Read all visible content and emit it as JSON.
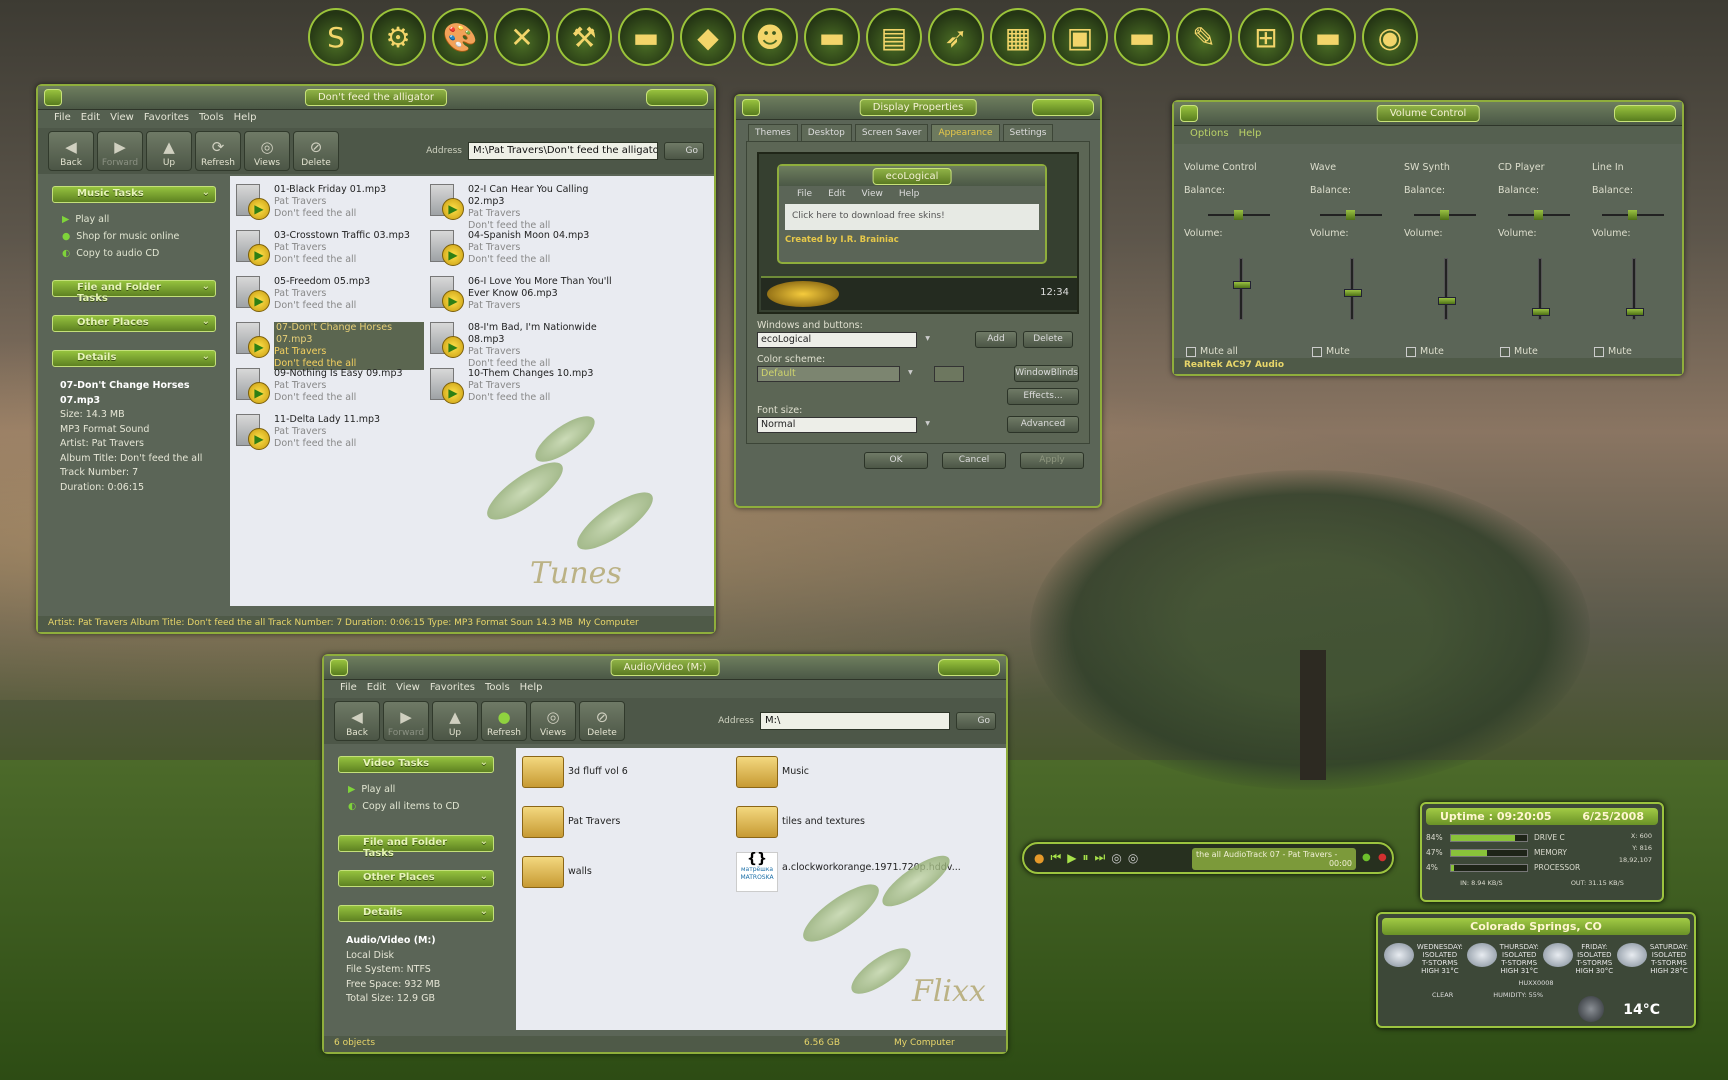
{
  "dock": [
    "s-logo-icon",
    "tools-icon",
    "palette-icon",
    "close-x-icon",
    "hammer-icon",
    "folder-icon",
    "shapes-icon",
    "user-icon",
    "folder-icon",
    "drive-icon",
    "xp-cursor-icon",
    "clapper-icon",
    "monitor-icon",
    "folder-icon",
    "pencil-icon",
    "windows-icon",
    "folder-icon",
    "globe-icon"
  ],
  "tunes": {
    "title": "Don't feed the alligator",
    "menu": [
      "File",
      "Edit",
      "View",
      "Favorites",
      "Tools",
      "Help"
    ],
    "toolbar": [
      "Back",
      "Forward",
      "Up",
      "Refresh",
      "Views",
      "Delete"
    ],
    "address_label": "Address",
    "address": "M:\\Pat Travers\\Don't feed the alligator",
    "go": "Go",
    "music_tasks": "Music Tasks",
    "tasks": [
      "Play all",
      "Shop for music online",
      "Copy to audio CD"
    ],
    "file_tasks": "File and Folder Tasks",
    "other_places": "Other Places",
    "details": "Details",
    "detail_name": "07-Don't Change Horses 07.mp3",
    "detail_lines": [
      "Size: 14.3 MB",
      "MP3 Format Sound",
      "Artist: Pat Travers",
      "Album Title: Don't feed the all",
      "Track Number: 7",
      "Duration: 0:06:15"
    ],
    "files": [
      {
        "name": "01-Black Friday 01.mp3",
        "artist": "Pat Travers",
        "album": "Don't feed the all"
      },
      {
        "name": "02-I Can Hear You Calling  02.mp3",
        "artist": "Pat Travers",
        "album": "Don't feed the all"
      },
      {
        "name": "03-Crosstown Traffic  03.mp3",
        "artist": "Pat Travers",
        "album": "Don't feed the all"
      },
      {
        "name": "04-Spanish Moon  04.mp3",
        "artist": "Pat Travers",
        "album": "Don't feed the all"
      },
      {
        "name": "05-Freedom  05.mp3",
        "artist": "Pat Travers",
        "album": "Don't feed the all"
      },
      {
        "name": "06-I Love You More Than You'll Ever Know  06.mp3",
        "artist": "Pat Travers",
        "album": ""
      },
      {
        "name": "07-Don't Change Horses   07.mp3",
        "artist": "Pat Travers",
        "album": "Don't feed the all"
      },
      {
        "name": "08-I'm Bad, I'm Nationwide   08.mp3",
        "artist": "Pat Travers",
        "album": "Don't feed the all"
      },
      {
        "name": "09-Nothing Is Easy  09.mp3",
        "artist": "Pat Travers",
        "album": "Don't feed the all"
      },
      {
        "name": "10-Them Changes  10.mp3",
        "artist": "Pat Travers",
        "album": "Don't feed the all"
      },
      {
        "name": "11-Delta Lady  11.mp3",
        "artist": "Pat Travers",
        "album": "Don't feed the all"
      }
    ],
    "watermark": "Tunes",
    "status": "Artist: Pat Travers Album Title: Don't feed the all Track Number: 7 Duration: 0:06:15 Type: MP3 Format Soun  14.3 MB",
    "status_right": "My Computer"
  },
  "display": {
    "title": "Display Properties",
    "tabs": [
      "Themes",
      "Desktop",
      "Screen Saver",
      "Appearance",
      "Settings"
    ],
    "preview_title": "ecoLogical",
    "preview_menu": [
      "File",
      "Edit",
      "View",
      "Help"
    ],
    "preview_text": "Click here to download free skins!",
    "preview_credit": "Created by I.R. Brainiac",
    "preview_time": "12:34",
    "win_label": "Windows and buttons:",
    "win_value": "ecoLogical",
    "color_label": "Color scheme:",
    "color_value": "Default",
    "font_label": "Font size:",
    "font_value": "Normal",
    "btn_add": "Add",
    "btn_delete": "Delete",
    "btn_wb": "WindowBlinds",
    "btn_effects": "Effects...",
    "btn_advanced": "Advanced",
    "btn_ok": "OK",
    "btn_cancel": "Cancel",
    "btn_apply": "Apply"
  },
  "volume": {
    "title": "Volume Control",
    "menu": [
      "Options",
      "Help"
    ],
    "channels": [
      {
        "name": "Volume Control",
        "mute": "Mute all",
        "level": 0.6
      },
      {
        "name": "Wave",
        "mute": "Mute",
        "level": 0.45
      },
      {
        "name": "SW Synth",
        "mute": "Mute",
        "level": 0.3
      },
      {
        "name": "CD Player",
        "mute": "Mute",
        "level": 0.1
      },
      {
        "name": "Line In",
        "mute": "Mute",
        "level": 0.1
      }
    ],
    "balance": "Balance:",
    "volume": "Volume:",
    "status": "Realtek AC97 Audio"
  },
  "flixx": {
    "title": "Audio/Video (M:)",
    "menu": [
      "File",
      "Edit",
      "View",
      "Favorites",
      "Tools",
      "Help"
    ],
    "toolbar": [
      "Back",
      "Forward",
      "Up",
      "Refresh",
      "Views",
      "Delete"
    ],
    "address_label": "Address",
    "address": "M:\\",
    "go": "Go",
    "video_tasks": "Video Tasks",
    "tasks": [
      "Play all",
      "Copy all items to CD"
    ],
    "file_tasks": "File and Folder Tasks",
    "other_places": "Other Places",
    "details": "Details",
    "detail_name": "Audio/Video (M:)",
    "detail_lines": [
      "Local Disk",
      "File System: NTFS",
      "Free Space: 932 MB",
      "Total Size: 12.9 GB"
    ],
    "items": [
      "3d fluff vol 6",
      "Music",
      "Pat Travers",
      "tiles and textures",
      "walls",
      "a.clockworkorange.1971.720p.hddv..."
    ],
    "mkv_label": "матрёшка MATROSKA",
    "watermark": "Flixx",
    "status_left": "6 objects",
    "status_mid": "6.56 GB",
    "status_right": "My Computer"
  },
  "player": {
    "text": "the all   AudioTrack 07 - Pat Travers -",
    "time": "00:00"
  },
  "sysmon": {
    "uptime": "Uptime : 09:20:05",
    "date": "6/25/2008",
    "rows": [
      {
        "pct": "84%",
        "label": "DRIVE C",
        "fill": 0.84
      },
      {
        "pct": "47%",
        "label": "MEMORY",
        "fill": 0.47
      },
      {
        "pct": "4%",
        "label": "PROCESSOR",
        "fill": 0.04
      }
    ],
    "xy": [
      "X:  600",
      "Y:  816",
      "18,92,107"
    ],
    "in": "IN:    8.94 KB/S",
    "out": "OUT:    31.15 KB/S"
  },
  "weather": {
    "city": "Colorado Springs, CO",
    "days": [
      {
        "d": "WEDNESDAY:",
        "c": "ISOLATED",
        "t": "T-STORMS",
        "h": "HIGH 31°C"
      },
      {
        "d": "THURSDAY:",
        "c": "ISOLATED",
        "t": "T-STORMS",
        "h": "HIGH 31°C"
      },
      {
        "d": "FRIDAY:",
        "c": "ISOLATED",
        "t": "T-STORMS",
        "h": "HIGH 30°C"
      },
      {
        "d": "SATURDAY:",
        "c": "ISOLATED",
        "t": "T-STORMS",
        "h": "HIGH 28°C"
      }
    ],
    "code": "HUXX0008",
    "clear": "CLEAR",
    "humidity": "HUMIDITY: 55%",
    "temp": "14°C"
  }
}
